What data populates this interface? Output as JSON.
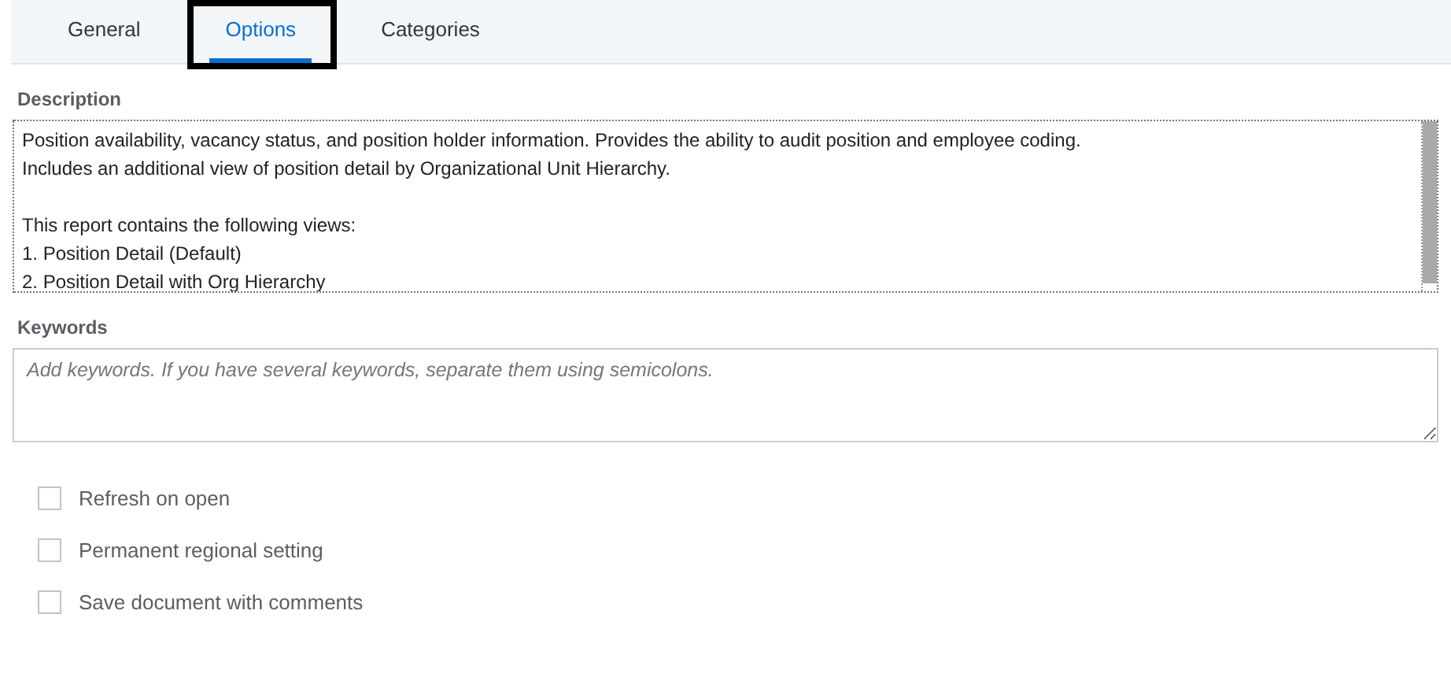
{
  "tabs": [
    {
      "label": "General",
      "selected": false,
      "highlighted": false
    },
    {
      "label": "Options",
      "selected": true,
      "highlighted": true
    },
    {
      "label": "Categories",
      "selected": false,
      "highlighted": false
    }
  ],
  "description": {
    "label": "Description",
    "paragraphs": [
      [
        "Position availability, vacancy status, and position holder information. Provides the ability to audit position and employee coding.",
        "Includes an additional view of position detail by Organizational Unit Hierarchy."
      ],
      [
        "This report contains the following views:",
        "1. Position Detail (Default)",
        "2. Position Detail with Org Hierarchy"
      ]
    ]
  },
  "keywords": {
    "label": "Keywords",
    "placeholder": "Add keywords. If you have several keywords, separate them using semicolons."
  },
  "options": [
    {
      "label": "Refresh on open",
      "checked": false
    },
    {
      "label": "Permanent regional setting",
      "checked": false
    },
    {
      "label": "Save document with comments",
      "checked": false
    }
  ]
}
